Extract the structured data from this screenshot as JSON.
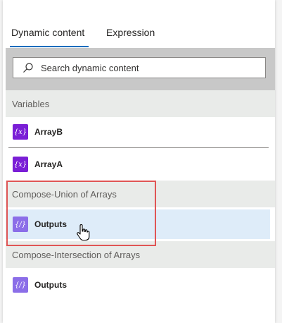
{
  "tabs": {
    "dynamic_content": "Dynamic content",
    "expression": "Expression"
  },
  "search": {
    "placeholder": "Search dynamic content"
  },
  "sections": [
    {
      "title": "Variables",
      "items": [
        {
          "label": "ArrayB",
          "icon": "variable-icon"
        },
        {
          "label": "ArrayA",
          "icon": "variable-icon"
        }
      ]
    },
    {
      "title": "Compose-Union of Arrays",
      "items": [
        {
          "label": "Outputs",
          "icon": "compose-icon",
          "state": "hovered"
        }
      ]
    },
    {
      "title": "Compose-Intersection of Arrays",
      "items": [
        {
          "label": "Outputs",
          "icon": "compose-icon"
        }
      ]
    }
  ],
  "icons": {
    "variable_glyph": "{x}",
    "compose_glyph": "{/}"
  },
  "colors": {
    "accent": "#0f6cbd",
    "variable_icon_bg": "#7a1fd6",
    "compose_icon_bg": "#8b6ee8",
    "hover_bg": "#deecf9",
    "highlight_border": "#e05555",
    "section_bg": "#e9ebe9"
  }
}
